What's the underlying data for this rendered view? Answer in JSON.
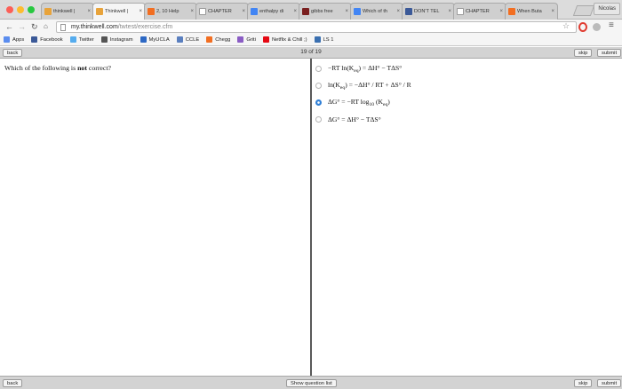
{
  "browser": {
    "tabs": [
      {
        "label": "thinkwell |",
        "icon": "thinkwell-icon",
        "color": "#e8a33a",
        "active": false
      },
      {
        "label": "Thinkwell |",
        "icon": "thinkwell-icon",
        "color": "#e8a33a",
        "active": true
      },
      {
        "label": "2, 10 Help",
        "icon": "chegg-icon",
        "color": "#f26e21",
        "active": false
      },
      {
        "label": "CHAPTER",
        "icon": "page-icon",
        "color": "#ffffff",
        "active": false
      },
      {
        "label": "enthalpy di",
        "icon": "google-icon",
        "color": "#4285f4",
        "active": false
      },
      {
        "label": "gibbs free",
        "icon": "pdf-icon",
        "color": "#7a1f1f",
        "active": false
      },
      {
        "label": "Which of th",
        "icon": "google-icon",
        "color": "#4285f4",
        "active": false
      },
      {
        "label": "DON'T TEL",
        "icon": "facebook-icon",
        "color": "#3b5998",
        "active": false
      },
      {
        "label": "CHAPTER",
        "icon": "page-icon",
        "color": "#ffffff",
        "active": false
      },
      {
        "label": "When Buta",
        "icon": "chegg-icon",
        "color": "#f26e21",
        "active": false
      }
    ],
    "profile_name": "Nicolas",
    "url_domain": "my.thinkwell.com",
    "url_path": "/twtest/exercise.cfm",
    "bookmarks": [
      {
        "label": "Apps",
        "icon": "apps-grid-icon",
        "color": "#5b8def"
      },
      {
        "label": "Facebook",
        "icon": "facebook-icon",
        "color": "#3b5998"
      },
      {
        "label": "Twitter",
        "icon": "twitter-icon",
        "color": "#55acee"
      },
      {
        "label": "Instagram",
        "icon": "instagram-icon",
        "color": "#555555"
      },
      {
        "label": "MyUCLA",
        "icon": "ucla-icon",
        "color": "#2d68c4"
      },
      {
        "label": "CCLE",
        "icon": "ccle-icon",
        "color": "#5a7fbf"
      },
      {
        "label": "Chegg",
        "icon": "chegg-icon",
        "color": "#f26e21"
      },
      {
        "label": "Griti",
        "icon": "griti-icon",
        "color": "#8a5cc4"
      },
      {
        "label": "Netflix & Chill ;)",
        "icon": "netflix-icon",
        "color": "#e50914"
      },
      {
        "label": "LS 1",
        "icon": "ls1-icon",
        "color": "#3a6fb0"
      }
    ]
  },
  "exercise": {
    "back_label": "back",
    "counter": "19 of 19",
    "skip_label": "skip",
    "submit_label": "submit",
    "question_prefix": "Which of the following is ",
    "question_emphasis": "not",
    "question_suffix": " correct?",
    "selected_option_index": 2,
    "options": [
      {
        "pre": "−RT ln(K",
        "sub": "eq",
        "post": ") = ΔH° − TΔS°"
      },
      {
        "pre": "ln(K",
        "sub": "eq",
        "post": ") = −ΔH° / RT + ΔS° / R"
      },
      {
        "pre": "ΔG° = −RT log",
        "sub": "10",
        "post": " (K",
        "sub2": "eq",
        "post2": ")"
      },
      {
        "pre": "ΔG° = ΔH° − TΔS°"
      }
    ],
    "footer_back_label": "back",
    "show_list_label": "Show question list",
    "footer_skip_label": "skip",
    "footer_submit_label": "submit"
  }
}
